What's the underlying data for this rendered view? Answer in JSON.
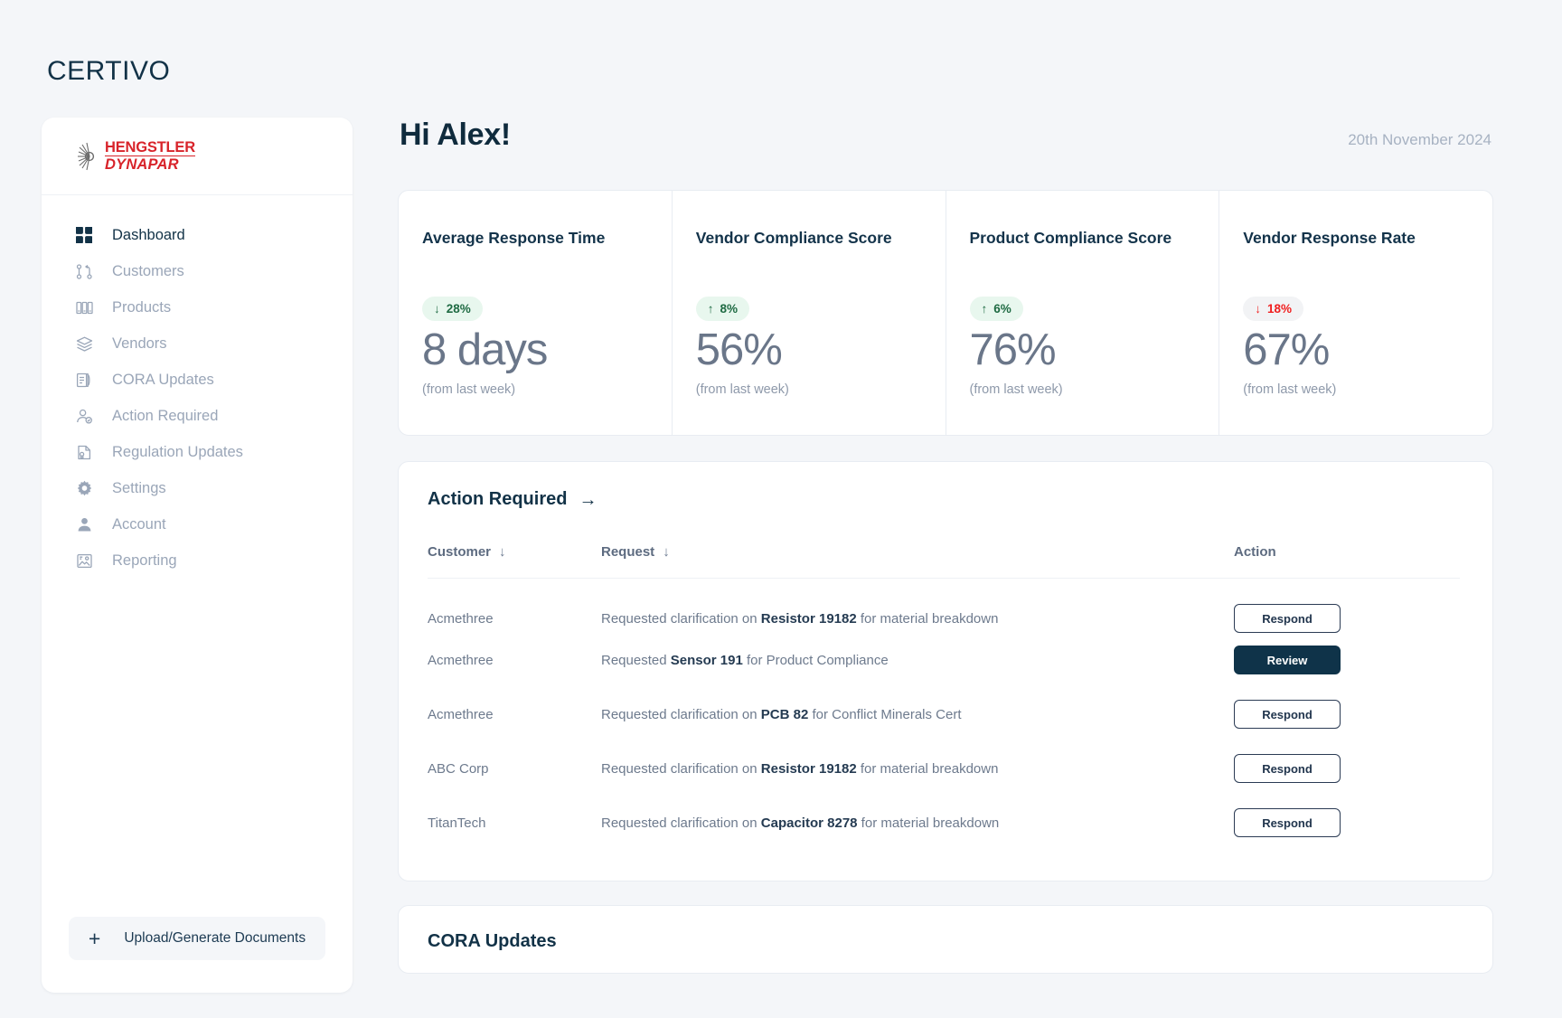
{
  "brand": {
    "name": "CERTIVO"
  },
  "sidebar": {
    "logo": {
      "line1": "HENGSTLER",
      "line2": "DYNAPAR",
      "alt": "Hengstler Dynapar"
    },
    "items": [
      {
        "label": "Dashboard",
        "icon": "grid-icon",
        "active": true
      },
      {
        "label": "Customers",
        "icon": "share-nodes-icon",
        "active": false
      },
      {
        "label": "Products",
        "icon": "boxes-icon",
        "active": false
      },
      {
        "label": "Vendors",
        "icon": "layers-icon",
        "active": false
      },
      {
        "label": "CORA Updates",
        "icon": "document-flip-icon",
        "active": false
      },
      {
        "label": "Action Required",
        "icon": "user-check-icon",
        "active": false
      },
      {
        "label": "Regulation Updates",
        "icon": "certificate-icon",
        "active": false
      },
      {
        "label": "Settings",
        "icon": "gear-icon",
        "active": false
      },
      {
        "label": "Account",
        "icon": "user-icon",
        "active": false
      },
      {
        "label": "Reporting",
        "icon": "image-chart-icon",
        "active": false
      }
    ],
    "upload_button": {
      "label": "Upload/Generate Documents",
      "icon": "plus-icon"
    }
  },
  "header": {
    "greeting": "Hi Alex!",
    "date": "20th November 2024"
  },
  "kpis": [
    {
      "title": "Average Response Time",
      "delta": "28%",
      "delta_direction": "down",
      "delta_tone": "good",
      "value": "8 days",
      "subtitle": "(from last week)"
    },
    {
      "title": "Vendor Compliance Score",
      "delta": "8%",
      "delta_direction": "up",
      "delta_tone": "good",
      "value": "56%",
      "subtitle": "(from last week)"
    },
    {
      "title": "Product Compliance Score",
      "delta": "6%",
      "delta_direction": "up",
      "delta_tone": "good",
      "value": "76%",
      "subtitle": "(from last week)"
    },
    {
      "title": "Vendor Response Rate",
      "delta": "18%",
      "delta_direction": "down",
      "delta_tone": "bad",
      "value": "67%",
      "subtitle": "(from last week)"
    }
  ],
  "action_required": {
    "title": "Action Required",
    "title_arrow": "→",
    "columns": [
      {
        "label": "Customer",
        "sortable": true,
        "sort_icon": "↓"
      },
      {
        "label": "Request",
        "sortable": true,
        "sort_icon": "↓"
      },
      {
        "label": "Action",
        "sortable": false,
        "sort_icon": ""
      }
    ],
    "rows": [
      {
        "customer": "Acmethree",
        "request_prefix": "Requested clarification on ",
        "request_item": "Resistor 19182",
        "request_suffix": " for material breakdown",
        "action_label": "Respond",
        "action_style": "outline"
      },
      {
        "customer": "Acmethree",
        "request_prefix": "Requested ",
        "request_item": "Sensor 191",
        "request_suffix": " for Product Compliance",
        "action_label": "Review",
        "action_style": "solid"
      },
      {
        "customer": "Acmethree",
        "request_prefix": "Requested clarification on ",
        "request_item": "PCB 82",
        "request_suffix": " for Conflict Minerals Cert",
        "action_label": "Respond",
        "action_style": "outline"
      },
      {
        "customer": "ABC Corp",
        "request_prefix": "Requested clarification on ",
        "request_item": "Resistor 19182",
        "request_suffix": " for material breakdown",
        "action_label": "Respond",
        "action_style": "outline"
      },
      {
        "customer": "TitanTech",
        "request_prefix": "Requested clarification on ",
        "request_item": "Capacitor 8278",
        "request_suffix": " for material breakdown",
        "action_label": "Respond",
        "action_style": "outline"
      }
    ]
  },
  "cora_updates": {
    "title": "CORA Updates"
  },
  "colors": {
    "page_bg": "#f4f6f9",
    "surface": "#ffffff",
    "brand_navy": "#123247",
    "muted_text": "#9aa6b8",
    "value_text": "#6a7689",
    "pill_good_bg": "#e8f7ee",
    "pill_good_text": "#1f6b43",
    "pill_bad_bg": "#f2f3f5",
    "pill_bad_text": "#f01f1f",
    "logo_red": "#d8232a",
    "button_solid_bg": "#0f3349"
  }
}
